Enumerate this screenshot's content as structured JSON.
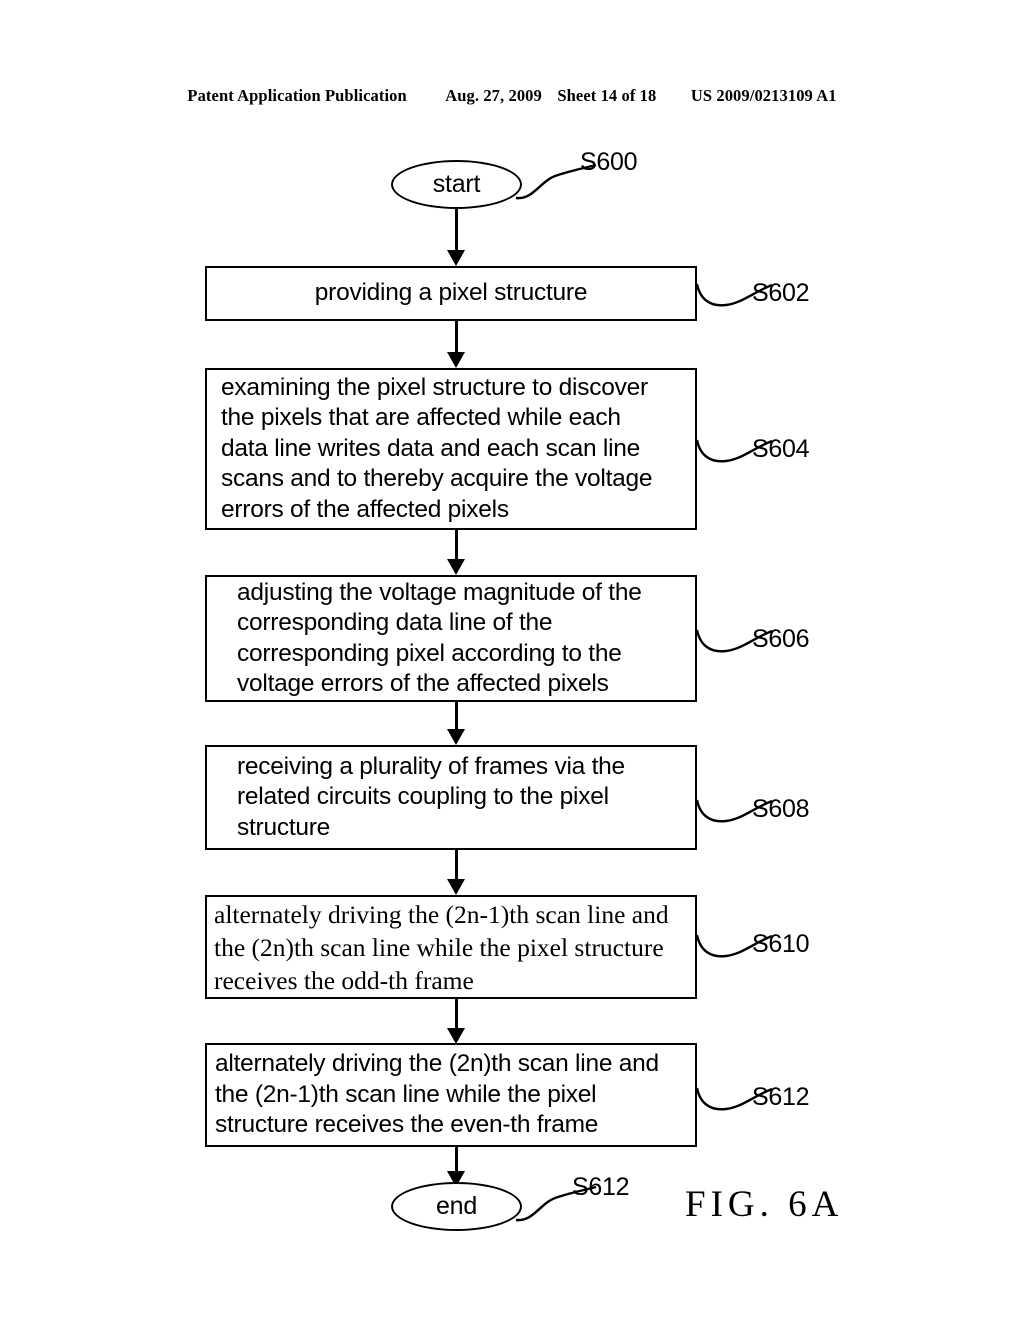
{
  "header": {
    "publication": "Patent Application Publication",
    "date": "Aug. 27, 2009",
    "sheet": "Sheet 14 of 18",
    "patent_number": "US 2009/0213109 A1"
  },
  "figure": {
    "caption": "FIG.  6A",
    "type": "flowchart"
  },
  "flow": {
    "start_node": {
      "label": "start",
      "step": "S600"
    },
    "end_node": {
      "label": "end",
      "step": "S612"
    },
    "steps": [
      {
        "step": "S602",
        "text": "providing a pixel structure",
        "align": "center",
        "font": "sans"
      },
      {
        "step": "S604",
        "text": "examining the pixel structure to discover\nthe pixels that are affected while each\ndata line writes data and each scan line\nscans and to thereby acquire the voltage\nerrors of the affected pixels",
        "align": "left",
        "font": "sans"
      },
      {
        "step": "S606",
        "text": "adjusting the voltage magnitude of the\ncorresponding data line of the\ncorresponding pixel according to the\nvoltage errors of the affected pixels",
        "align": "left",
        "font": "sans"
      },
      {
        "step": "S608",
        "text": "receiving a plurality of frames via the\nrelated circuits coupling to the pixel\nstructure",
        "align": "left",
        "font": "sans"
      },
      {
        "step": "S610",
        "text": "alternately driving the (2n-1)th scan line and\nthe (2n)th scan line while the pixel structure\nreceives the odd-th frame",
        "align": "left",
        "font": "serif"
      },
      {
        "step": "S612",
        "text": "alternately driving the (2n)th scan line and\nthe (2n-1)th scan line while the pixel\nstructure receives the even-th frame",
        "align": "left",
        "font": "sans"
      }
    ]
  },
  "colors": {
    "ink": "#000000",
    "paper": "#ffffff"
  }
}
